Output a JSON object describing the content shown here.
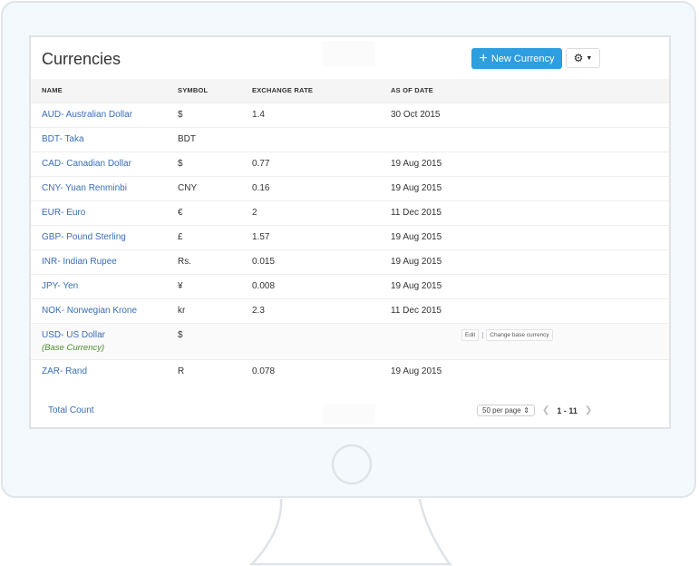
{
  "page": {
    "title": "Currencies",
    "new_button_label": "New Currency",
    "new_button_icon": "plus-icon",
    "settings_icon": "gear-icon",
    "accent_color": "#2d9ee0"
  },
  "table": {
    "columns": [
      "NAME",
      "SYMBOL",
      "EXCHANGE RATE",
      "AS OF DATE"
    ],
    "rows": [
      {
        "name": "AUD- Australian Dollar",
        "symbol": "$",
        "rate": "1.4",
        "date": "30 Oct 2015"
      },
      {
        "name": "BDT- Taka",
        "symbol": "BDT",
        "rate": "",
        "date": ""
      },
      {
        "name": "CAD- Canadian Dollar",
        "symbol": "$",
        "rate": "0.77",
        "date": "19 Aug 2015"
      },
      {
        "name": "CNY- Yuan Renminbi",
        "symbol": "CNY",
        "rate": "0.16",
        "date": "19 Aug 2015"
      },
      {
        "name": "EUR- Euro",
        "symbol": "€",
        "rate": "2",
        "date": "11 Dec 2015"
      },
      {
        "name": "GBP- Pound Sterling",
        "symbol": "£",
        "rate": "1.57",
        "date": "19 Aug 2015"
      },
      {
        "name": "INR- Indian Rupee",
        "symbol": "Rs.",
        "rate": "0.015",
        "date": "19 Aug 2015"
      },
      {
        "name": "JPY- Yen",
        "symbol": "¥",
        "rate": "0.008",
        "date": "19 Aug 2015"
      },
      {
        "name": "NOK- Norwegian Krone",
        "symbol": "kr",
        "rate": "2.3",
        "date": "11 Dec 2015"
      },
      {
        "name": "USD- US Dollar",
        "note": "(Base Currency)",
        "symbol": "$",
        "rate": "",
        "date": "",
        "actions": [
          "Edit",
          "Change base currency"
        ]
      },
      {
        "name": "ZAR- Rand",
        "symbol": "R",
        "rate": "0.078",
        "date": "19 Aug 2015"
      }
    ]
  },
  "footer": {
    "total_label": "Total Count",
    "per_page": "50 per page",
    "range": "1 - 11"
  }
}
